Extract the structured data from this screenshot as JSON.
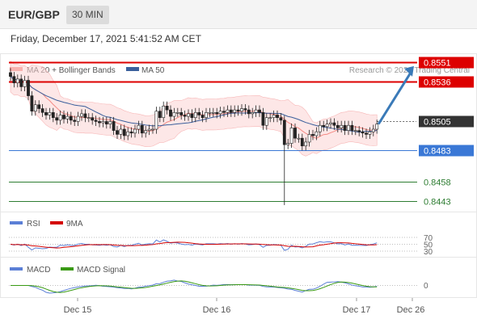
{
  "header": {
    "pair": "EUR/GBP",
    "timeframe": "30 MIN",
    "datetime": "Friday, December 17, 2021 5:41:52 AM CET"
  },
  "legend": {
    "ma20": "MA 20 + Bollinger Bands",
    "ma50": "MA 50",
    "credit": "Research © 2021 Trading Central"
  },
  "colors": {
    "ma20": "#f48a84",
    "ma50": "#3a5f9c",
    "resistance": "#dd0000",
    "support": "#3a78d6",
    "target": "#3a7ab8",
    "green": "#2e7d32",
    "rsi": "#5b7fd6",
    "rsi_ma": "#d40000",
    "macd": "#5b7fd6",
    "macd_signal": "#3a9a14",
    "band": "#fbd3d3"
  },
  "chart_data": {
    "type": "candlestick",
    "ylim": [
      0.8435,
      0.8558
    ],
    "levels": [
      {
        "label": "0.8551",
        "value": 0.8551,
        "kind": "resistance"
      },
      {
        "label": "0.8536",
        "value": 0.8536,
        "kind": "resistance"
      },
      {
        "label": "0.8505",
        "value": 0.8505,
        "kind": "last"
      },
      {
        "label": "0.8483",
        "value": 0.8483,
        "kind": "support"
      },
      {
        "label": "0.8458",
        "value": 0.8458,
        "kind": "green"
      },
      {
        "label": "0.8443",
        "value": 0.8443,
        "kind": "green"
      }
    ],
    "target_arrow": {
      "from": 0.8503,
      "to": 0.8548
    },
    "closes": [
      0.854,
      0.8535,
      0.8538,
      0.8532,
      0.8537,
      0.8525,
      0.8513,
      0.8518,
      0.8515,
      0.8512,
      0.851,
      0.8512,
      0.8508,
      0.8506,
      0.851,
      0.8507,
      0.8509,
      0.8506,
      0.8505,
      0.8509,
      0.8511,
      0.8508,
      0.8508,
      0.8506,
      0.8505,
      0.8504,
      0.8505,
      0.8503,
      0.8505,
      0.8498,
      0.8495,
      0.8499,
      0.8494,
      0.8497,
      0.8496,
      0.8499,
      0.8502,
      0.8496,
      0.8498,
      0.8499,
      0.8499,
      0.8513,
      0.8508,
      0.8517,
      0.8514,
      0.8509,
      0.8512,
      0.8512,
      0.851,
      0.8509,
      0.8511,
      0.8508,
      0.8512,
      0.851,
      0.8508,
      0.8512,
      0.8512,
      0.8512,
      0.8511,
      0.8513,
      0.8512,
      0.8514,
      0.8512,
      0.8514,
      0.8513,
      0.8515,
      0.8514,
      0.8511,
      0.8512,
      0.8514,
      0.8512,
      0.8502,
      0.8508,
      0.8508,
      0.851,
      0.8508,
      0.8506,
      0.8487,
      0.8488,
      0.85,
      0.8492,
      0.8492,
      0.8486,
      0.8489,
      0.8495,
      0.8494,
      0.8497,
      0.8502,
      0.8501,
      0.8503,
      0.8504,
      0.8502,
      0.85,
      0.8502,
      0.8498,
      0.8502,
      0.8498,
      0.8498,
      0.8497,
      0.8496,
      0.8495,
      0.8497,
      0.8499,
      0.8503
    ],
    "rsi": {
      "levels": [
        70,
        50,
        30
      ],
      "labels": [
        "70",
        "50",
        "30"
      ],
      "series_label": "RSI",
      "ma_label": "9MA"
    },
    "macd": {
      "zero_label": "0",
      "series_label": "MACD",
      "signal_label": "MACD Signal"
    },
    "x_ticks": [
      "Dec 15",
      "Dec 16",
      "Dec 17",
      "Dec 26"
    ]
  }
}
